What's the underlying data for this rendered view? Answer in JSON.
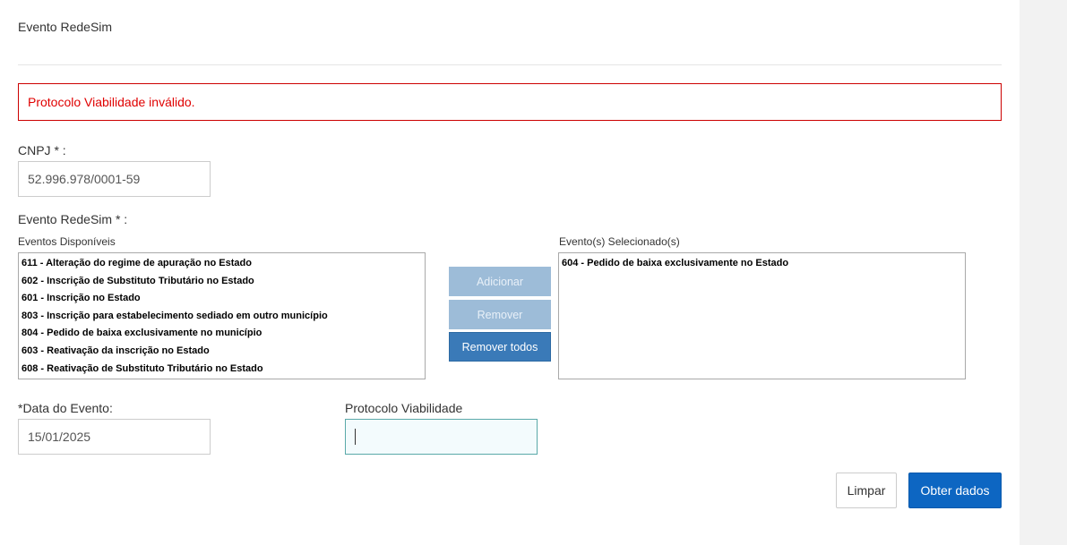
{
  "page": {
    "title": "Evento RedeSim"
  },
  "alert": {
    "message": "Protocolo Viabilidade inválido.",
    "color": "#e00000"
  },
  "cnpj": {
    "label": "CNPJ * :",
    "value": "52.996.978/0001-59"
  },
  "evento": {
    "label": "Evento RedeSim * :",
    "available_label": "Eventos Disponíveis",
    "selected_label": "Evento(s) Selecionado(s)",
    "available_items": [
      "611 - Alteração do regime de apuração no Estado",
      "602 - Inscrição de Substituto Tributário no Estado",
      "601 - Inscrição no Estado",
      "803 - Inscrição para estabelecimento sediado em outro município",
      "804 - Pedido de baixa exclusivamente no município",
      "603 - Reativação da inscrição no Estado",
      "608 - Reativação de Substituto Tributário no Estado"
    ],
    "selected_items": [
      "604 - Pedido de baixa exclusivamente no Estado"
    ],
    "add_label": "Adicionar",
    "remove_label": "Remover",
    "remove_all_label": "Remover todos"
  },
  "data_evento": {
    "label": "*Data do Evento:",
    "value": "15/01/2025"
  },
  "protocolo": {
    "label": "Protocolo Viabilidade",
    "value": ""
  },
  "actions": {
    "clear_label": "Limpar",
    "submit_label": "Obter dados",
    "primary_color": "#0d66c2"
  }
}
